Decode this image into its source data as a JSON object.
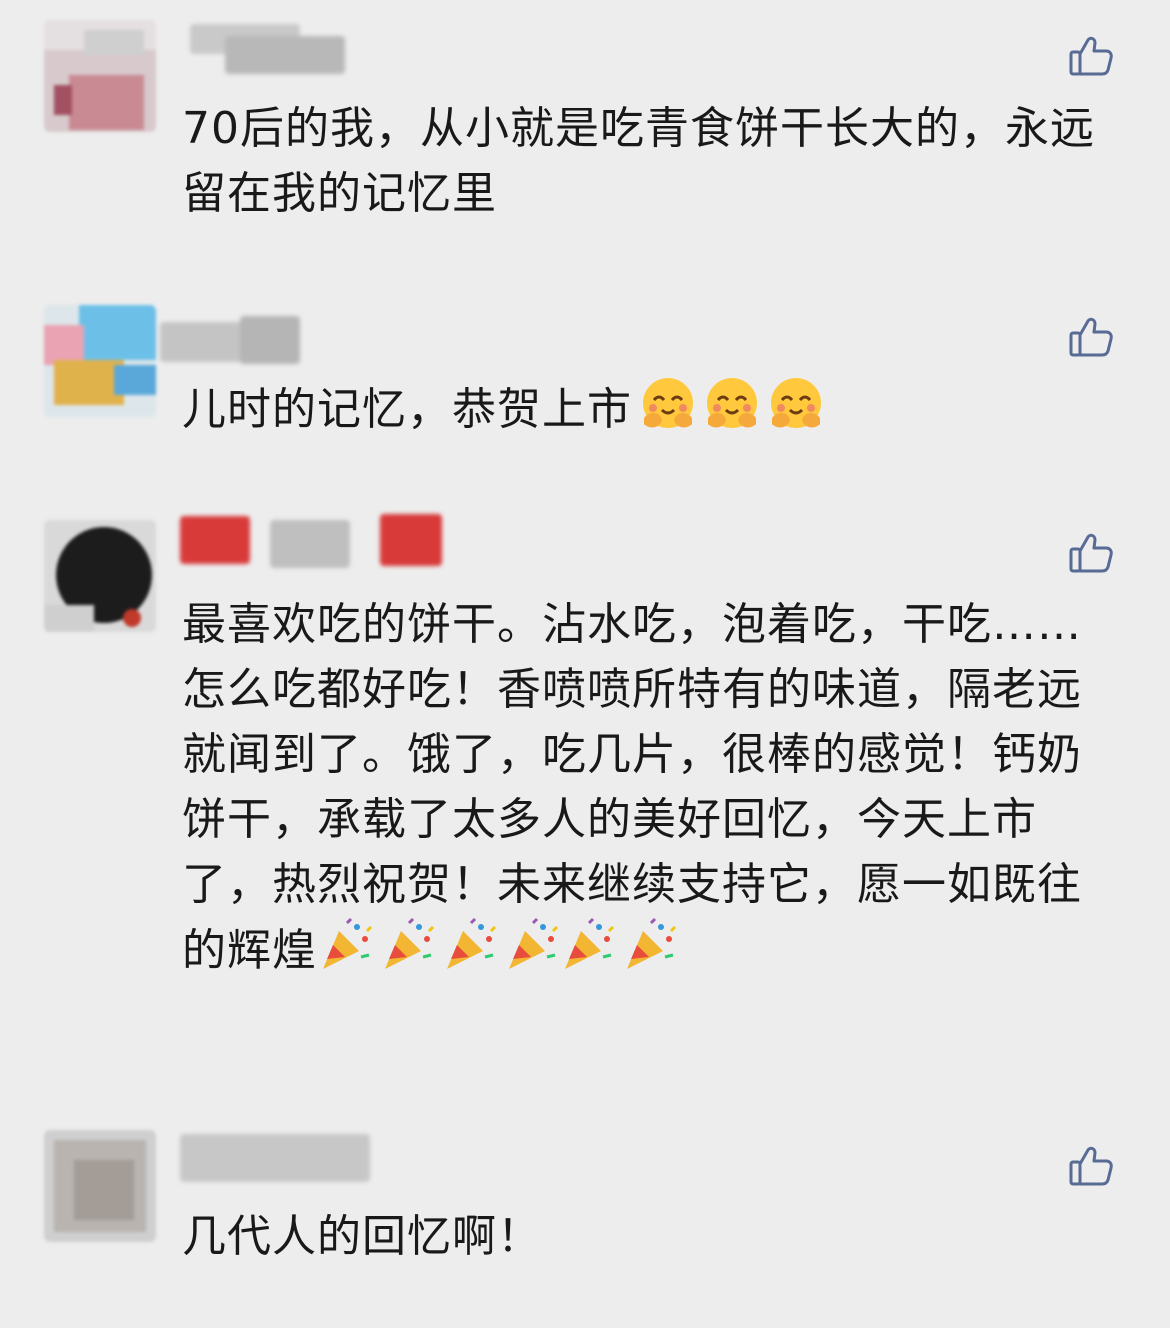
{
  "comments": [
    {
      "nickname_visible": "",
      "text": "70后的我，从小就是吃青食饼干长大的，永远留在我的记忆里",
      "like_icon": "thumbs-up-outline-icon"
    },
    {
      "nickname_visible": "",
      "text": "儿时的记忆，恭贺上市",
      "emojis": [
        "hugging-face-emoji",
        "hugging-face-emoji",
        "hugging-face-emoji"
      ],
      "like_icon": "thumbs-up-outline-icon"
    },
    {
      "nickname_visible": "",
      "text": "最喜欢吃的饼干。沾水吃，泡着吃，干吃……怎么吃都好吃！香喷喷所特有的味道，隔老远就闻到了。饿了，吃几片，很棒的感觉！钙奶饼干，承载了太多人的美好回忆，今天上市了，热烈祝贺！未来继续支持它，愿一如既往的辉煌",
      "emojis": [
        "party-popper-emoji",
        "party-popper-emoji",
        "party-popper-emoji",
        "party-popper-emoji",
        "party-popper-emoji",
        "party-popper-emoji"
      ],
      "like_icon": "thumbs-up-outline-icon"
    },
    {
      "nickname_visible": "",
      "text": "几代人的回忆啊！",
      "like_icon": "thumbs-up-outline-icon"
    }
  ],
  "colors": {
    "background": "#ededed",
    "text": "#191919",
    "like_icon": "#576b95"
  }
}
